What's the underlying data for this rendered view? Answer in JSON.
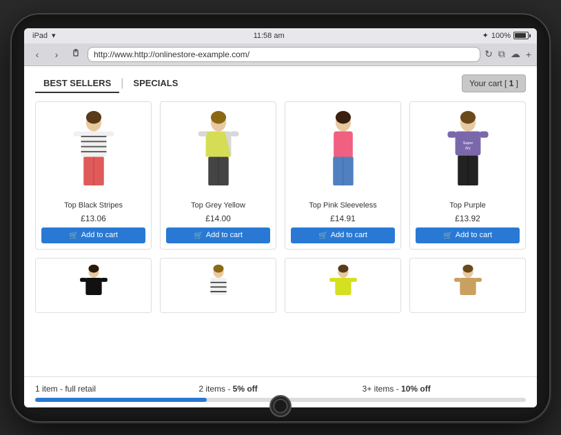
{
  "device": {
    "status_bar": {
      "left": "iPad",
      "wifi": "▾",
      "time": "11:58 am",
      "bluetooth": "✦",
      "battery_pct": "100%"
    },
    "browser": {
      "url": "http://www.http://onlinestore-example.com/",
      "back_label": "‹",
      "forward_label": "›",
      "refresh_label": "↻"
    }
  },
  "shop": {
    "cart_label": "Your cart",
    "cart_count": "1",
    "tabs": [
      {
        "label": "BEST SELLERS",
        "active": true
      },
      {
        "label": "SPECIALS",
        "active": false
      }
    ],
    "products_row1": [
      {
        "name": "Top Black Stripes",
        "price": "£13.06",
        "add_to_cart": "Add to cart",
        "color_top": "#f0f0f0",
        "color_stripes": "#333",
        "color_bottom": "#e05a5a"
      },
      {
        "name": "Top Grey Yellow",
        "price": "£14.00",
        "add_to_cart": "Add to cart",
        "color_top": "#d8d8d8",
        "color_accent": "#d4e020",
        "color_bottom": "#555"
      },
      {
        "name": "Top Pink Sleeveless",
        "price": "£14.91",
        "add_to_cart": "Add to cart",
        "color_top": "#f06080",
        "color_bottom": "#f06080"
      },
      {
        "name": "Top Purple",
        "price": "£13.92",
        "add_to_cart": "Add to cart",
        "color_top": "#7b68ab",
        "color_bottom": "#222"
      }
    ],
    "promo": {
      "tier1": "1 item - full retail",
      "tier2_prefix": "2 items - ",
      "tier2_highlight": "5% off",
      "tier3_prefix": "3+ items - ",
      "tier3_highlight": "10% off",
      "progress_pct": 35
    }
  }
}
